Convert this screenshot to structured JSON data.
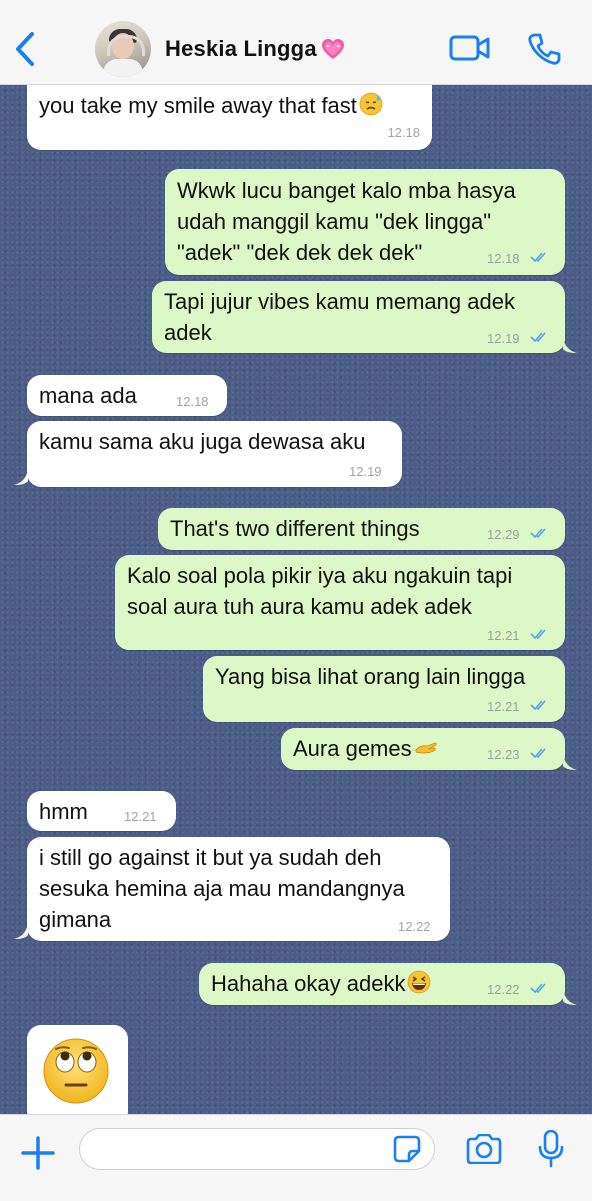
{
  "header": {
    "contact_name": "Heskia Lingga",
    "name_emoji": "heart-icon",
    "back_icon": "chevron-left-icon",
    "video_icon": "video-call-icon",
    "call_icon": "phone-icon",
    "accent": "#1a7ff0"
  },
  "messages": [
    {
      "dir": "in",
      "text": "you take my smile away that fast",
      "time": "12.18"
    },
    {
      "dir": "out",
      "lines": [
        "Wkwk lucu banget kalo mba hasya",
        "udah manggil kamu \"dek lingga\"",
        "\"adek\" \"dek dek dek dek\""
      ],
      "time": "12.18"
    },
    {
      "dir": "out",
      "lines": [
        "Tapi jujur vibes kamu memang adek",
        "adek"
      ],
      "time": "12.19"
    },
    {
      "dir": "in",
      "text": "mana ada",
      "time": "12.18"
    },
    {
      "dir": "in",
      "text": "kamu sama aku juga dewasa aku",
      "time": "12.19"
    },
    {
      "dir": "out",
      "text": "That's two different things",
      "time": "12.29"
    },
    {
      "dir": "out",
      "lines": [
        "Kalo soal pola pikir iya aku ngakuin tapi",
        "soal aura tuh aura kamu adek adek"
      ],
      "time": "12.21"
    },
    {
      "dir": "out",
      "text": "Yang bisa lihat orang lain lingga",
      "time": "12.21"
    },
    {
      "dir": "out",
      "text": "Aura gemes",
      "time": "12.23"
    },
    {
      "dir": "in",
      "text": "hmm",
      "time": "12.21"
    },
    {
      "dir": "in",
      "lines": [
        "i still go against it but ya sudah deh",
        "sesuka hemina aja mau mandangnya",
        "gimana"
      ],
      "time": "12.22"
    },
    {
      "dir": "out",
      "text": "Hahaha okay adekk",
      "time": "12.22"
    },
    {
      "dir": "in",
      "emoji": "face-with-rolling-eyes-emoji"
    }
  ],
  "colors": {
    "incoming_bubble": "#ffffff",
    "outgoing_bubble": "#dcf8c6",
    "read_ticks": "#4fa9e8",
    "chat_background": "#4c5d88"
  },
  "input_bar": {
    "text_value": "",
    "plus_icon": "plus-icon",
    "sticker_icon": "sticker-icon",
    "camera_icon": "camera-icon",
    "mic_icon": "microphone-icon"
  }
}
